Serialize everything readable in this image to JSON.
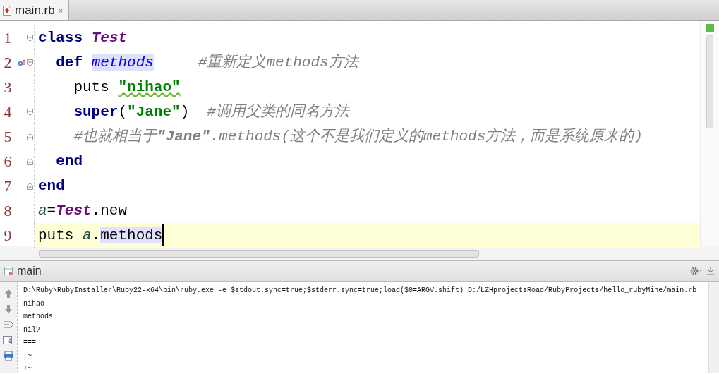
{
  "tab": {
    "title": "main.rb",
    "close": "×",
    "selected": true
  },
  "editor": {
    "lines": [
      {
        "number": "1",
        "fold_open": true,
        "tokens": [
          {
            "kind": "keyword",
            "text": "class "
          },
          {
            "kind": "const",
            "text": "Test"
          }
        ]
      },
      {
        "number": "2",
        "fold_open": true,
        "override": true,
        "tokens": [
          {
            "kind": "keyword",
            "text": "  def "
          },
          {
            "kind": "method",
            "text": "methods",
            "highlight": true
          },
          {
            "kind": "comment",
            "text": "     #重新定义methods方法"
          }
        ]
      },
      {
        "number": "3",
        "tokens": [
          {
            "kind": "plain",
            "text": "    puts "
          },
          {
            "kind": "string",
            "text": "\"nihao\"",
            "typo": true
          }
        ]
      },
      {
        "number": "4",
        "fold_open": true,
        "tokens": [
          {
            "kind": "keyword",
            "text": "    super"
          },
          {
            "kind": "plain",
            "text": "("
          },
          {
            "kind": "string",
            "text": "\"Jane\""
          },
          {
            "kind": "plain",
            "text": ")  "
          },
          {
            "kind": "comment",
            "text": "#调用父类的同名方法"
          }
        ]
      },
      {
        "number": "5",
        "fold_close": true,
        "tokens": [
          {
            "kind": "comment",
            "text": "    #也就相当于**\"Jane\"**.methods(这个不是我们定义的methods方法，而是系统原来的)"
          }
        ]
      },
      {
        "number": "6",
        "fold_close": true,
        "tokens": [
          {
            "kind": "keyword",
            "text": "  end"
          }
        ]
      },
      {
        "number": "7",
        "fold_close": true,
        "tokens": [
          {
            "kind": "keyword",
            "text": "end"
          }
        ]
      },
      {
        "number": "8",
        "tokens": [
          {
            "kind": "var",
            "text": "a"
          },
          {
            "kind": "plain",
            "text": "="
          },
          {
            "kind": "const",
            "text": "Test"
          },
          {
            "kind": "plain",
            "text": ".new"
          }
        ]
      },
      {
        "number": "9",
        "current": true,
        "tokens": [
          {
            "kind": "plain",
            "text": "puts "
          },
          {
            "kind": "var",
            "text": "a"
          },
          {
            "kind": "plain",
            "text": "."
          },
          {
            "kind": "plain",
            "text": "methods",
            "highlight": true
          }
        ]
      }
    ]
  },
  "run_panel": {
    "title": "main",
    "output": [
      "D:\\Ruby\\RubyInstaller\\Ruby22-x64\\bin\\ruby.exe -e $stdout.sync=true;$stderr.sync=true;load($0=ARGV.shift) D:/LZHprojectsRoad/RubyProjects/hello_rubyMine/main.rb",
      "nihao",
      "methods",
      "nil?",
      "===",
      "=~",
      "!~"
    ]
  }
}
